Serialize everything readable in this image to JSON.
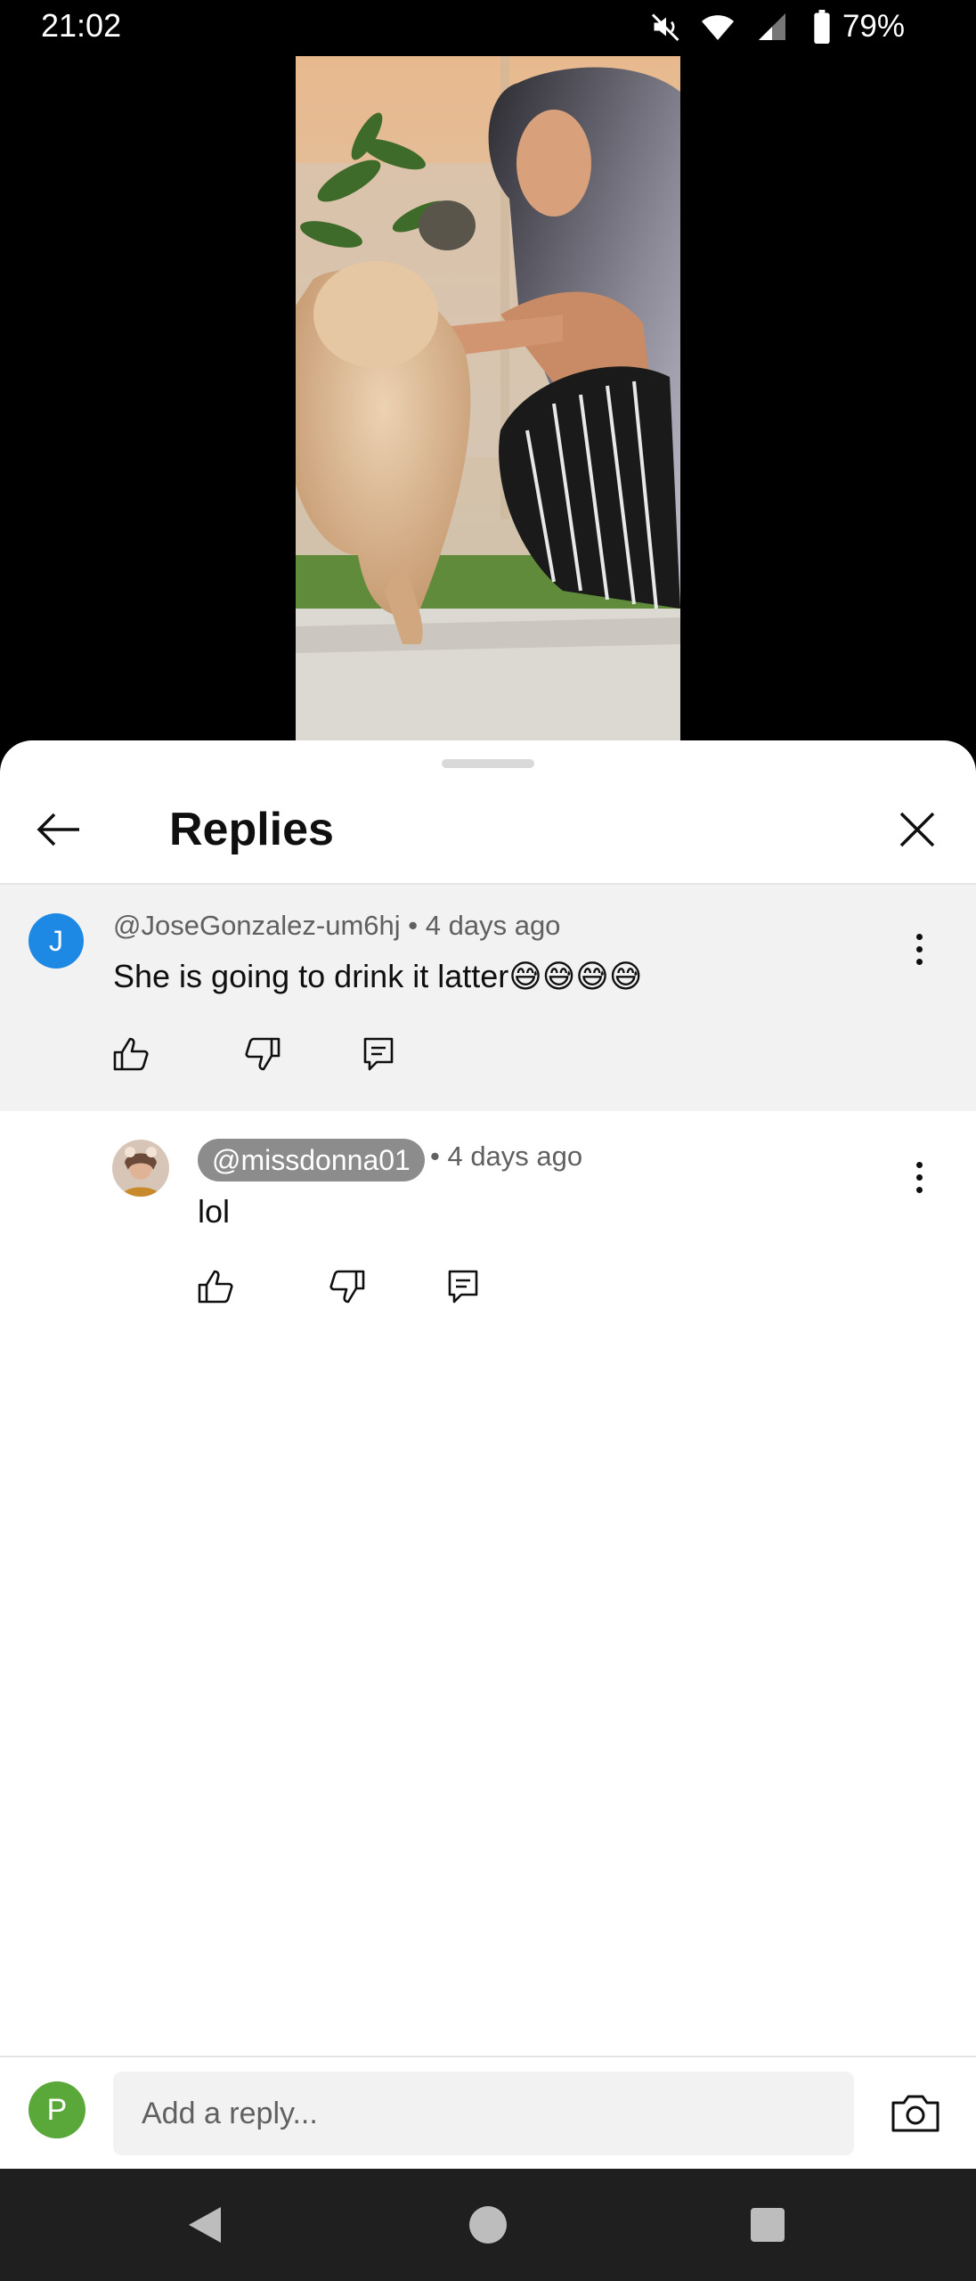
{
  "status_bar": {
    "time": "21:02",
    "battery_percent": "79%",
    "icons": [
      "mute-icon",
      "wifi-icon",
      "cell-signal-icon",
      "battery-icon"
    ]
  },
  "video": {
    "description_icon": "video-frame"
  },
  "sheet": {
    "title": "Replies"
  },
  "parent_comment": {
    "avatar_letter": "J",
    "avatar_color": "#1e88e5",
    "author": "@JoseGonzalez-um6hj",
    "time": " • 4 days ago",
    "text": "She is going to drink it  latter😅😅😅😅"
  },
  "reply": {
    "author": "@missdonna01",
    "time": " • 4 days ago",
    "text": "lol"
  },
  "reply_bar": {
    "avatar_letter": "P",
    "avatar_color": "#59a839",
    "placeholder": "Add a reply..."
  },
  "colors": {
    "parent_bg": "#f2f2f2",
    "chip_bg": "#8c8c8c"
  }
}
